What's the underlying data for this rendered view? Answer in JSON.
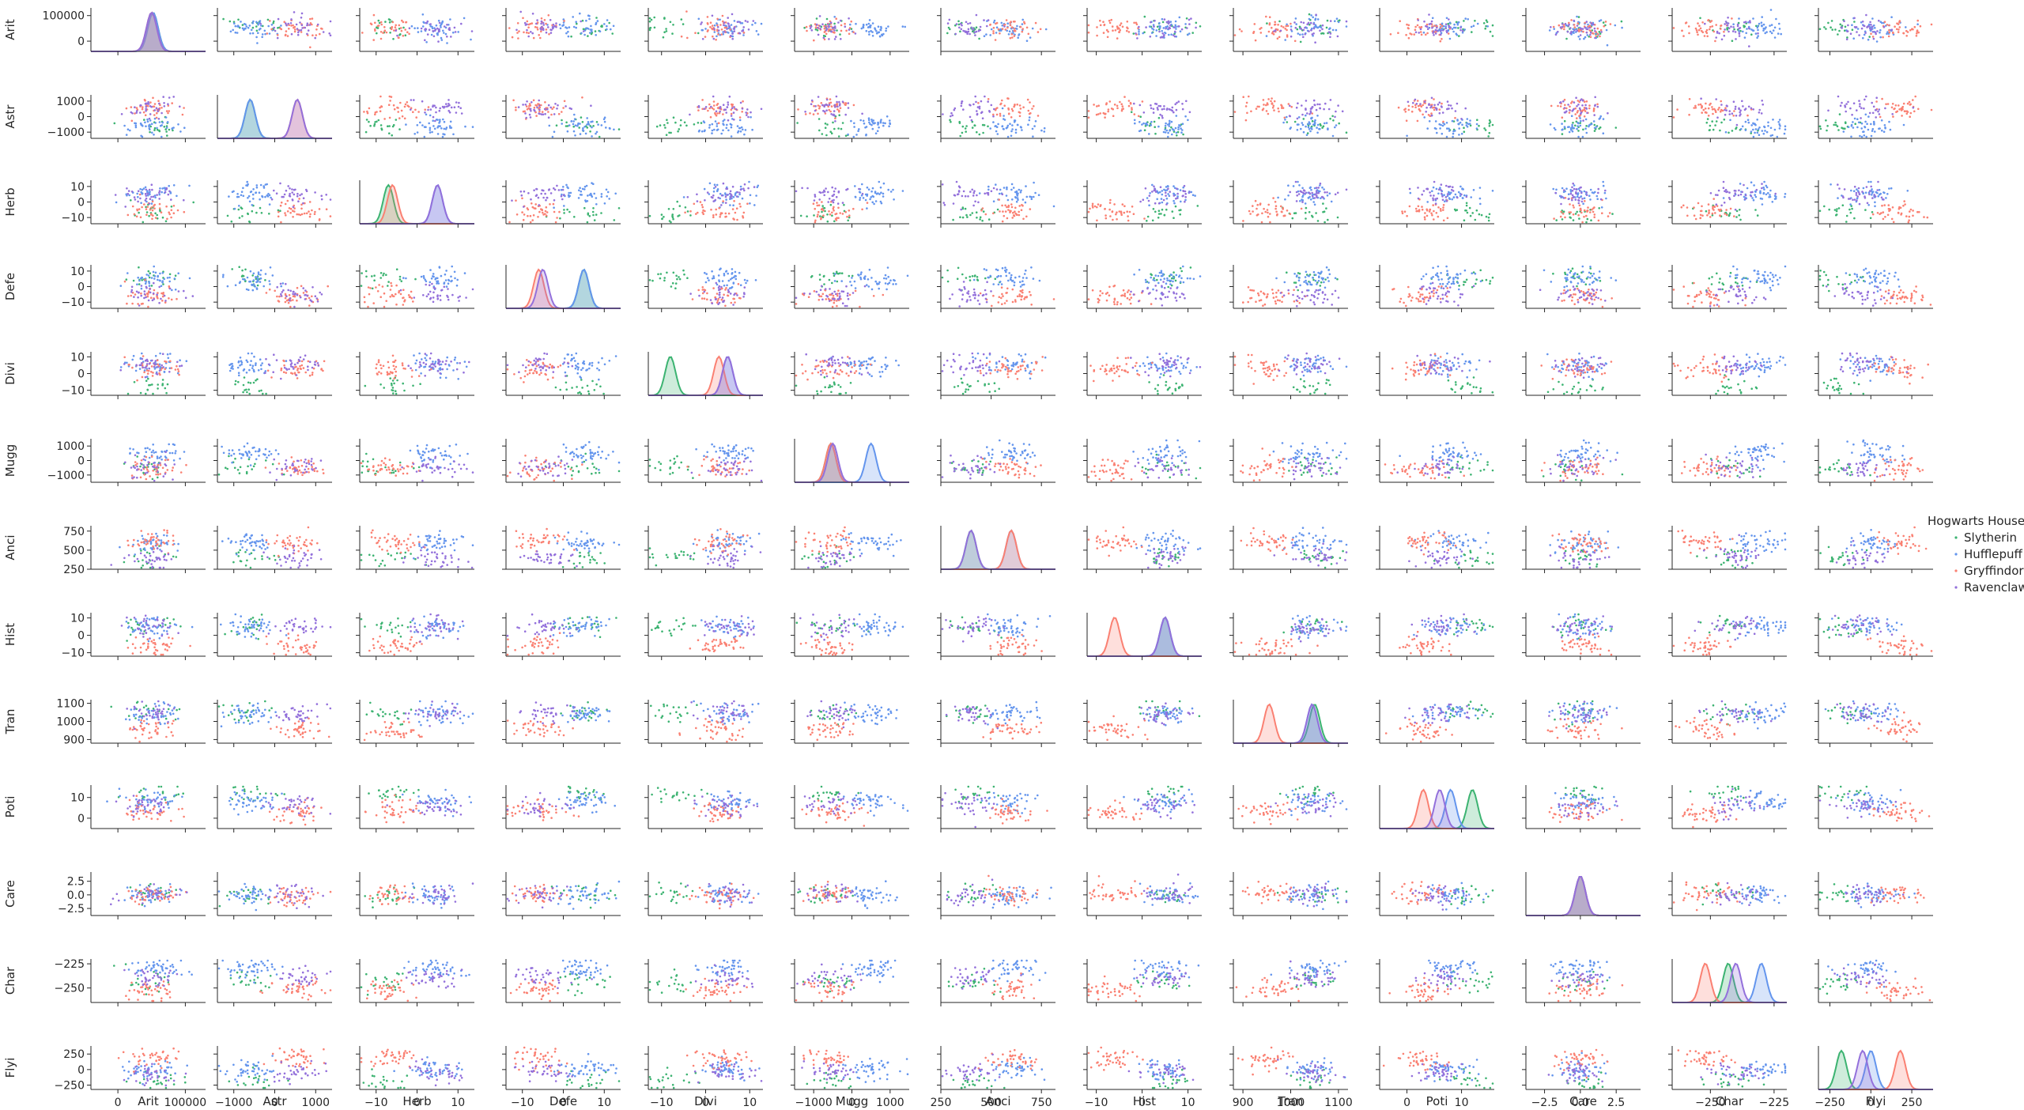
{
  "chart_data": {
    "type": "scatter",
    "subtype": "pairplot",
    "diagonal": "kde",
    "variables": [
      "Arit",
      "Astr",
      "Herb",
      "Defe",
      "Divi",
      "Mugg",
      "Anci",
      "Hist",
      "Tran",
      "Poti",
      "Care",
      "Char",
      "Flyi"
    ],
    "ranges": {
      "Arit": [
        -40000,
        130000
      ],
      "Astr": [
        -1400,
        1400
      ],
      "Herb": [
        -14,
        14
      ],
      "Defe": [
        -14,
        14
      ],
      "Divi": [
        -13,
        13
      ],
      "Mugg": [
        -1500,
        1500
      ],
      "Anci": [
        250,
        820
      ],
      "Hist": [
        -12,
        13
      ],
      "Tran": [
        880,
        1120
      ],
      "Poti": [
        -5,
        16
      ],
      "Care": [
        -3.8,
        4.2
      ],
      "Char": [
        -265,
        -220
      ],
      "Flyi": [
        -320,
        380
      ]
    },
    "ticks": {
      "Arit": {
        "values": [
          0,
          100000
        ],
        "labels": [
          "0",
          "100000"
        ]
      },
      "Astr": {
        "values": [
          -1000,
          0,
          1000
        ],
        "labels": [
          "−1000",
          "0",
          "1000"
        ]
      },
      "Herb": {
        "values": [
          -10,
          0,
          10
        ],
        "labels": [
          "−10",
          "0",
          "10"
        ]
      },
      "Defe": {
        "values": [
          -10,
          0,
          10
        ],
        "labels": [
          "−10",
          "0",
          "10"
        ]
      },
      "Divi": {
        "values": [
          -10,
          0,
          10
        ],
        "labels": [
          "−10",
          "0",
          "10"
        ]
      },
      "Mugg": {
        "values": [
          -1000,
          0,
          1000
        ],
        "labels": [
          "−1000",
          "0",
          "1000"
        ]
      },
      "Anci": {
        "values": [
          250,
          500,
          750
        ],
        "labels": [
          "250",
          "500",
          "750"
        ]
      },
      "Hist": {
        "values": [
          -10,
          0,
          10
        ],
        "labels": [
          "−10",
          "0",
          "10"
        ]
      },
      "Tran": {
        "values": [
          900,
          1000,
          1100
        ],
        "labels": [
          "900",
          "1000",
          "1100"
        ]
      },
      "Poti": {
        "values": [
          0,
          10
        ],
        "labels": [
          "0",
          "10"
        ]
      },
      "Care": {
        "values": [
          -2.5,
          0,
          2.5
        ],
        "labels": [
          "−2.5",
          "0.0",
          "2.5"
        ]
      },
      "Char": {
        "values": [
          -250,
          -225
        ],
        "labels": [
          "−250",
          "−225"
        ]
      },
      "Flyi": {
        "values": [
          -250,
          0,
          250
        ],
        "labels": [
          "−250",
          "0",
          "250"
        ]
      }
    },
    "legend": {
      "title": "Hogwarts House",
      "placement": "right",
      "entries": [
        {
          "name": "Slytherin",
          "color": "#3cb371"
        },
        {
          "name": "Hufflepuff",
          "color": "#6495ed"
        },
        {
          "name": "Gryffindor",
          "color": "#fa8072"
        },
        {
          "name": "Ravenclaw",
          "color": "#9370db"
        }
      ]
    },
    "series": [
      {
        "name": "Slytherin",
        "color": "#3cb371",
        "points_per_panel": 20,
        "means": [
          52000,
          -600,
          -7,
          5,
          -8,
          -550,
          400,
          5,
          1050,
          12,
          0,
          -243,
          -180
        ]
      },
      {
        "name": "Hufflepuff",
        "color": "#6495ed",
        "points_per_panel": 45,
        "means": [
          52000,
          -600,
          5,
          5,
          5,
          500,
          600,
          5,
          1045,
          8,
          0,
          -230,
          0
        ]
      },
      {
        "name": "Gryffindor",
        "color": "#fa8072",
        "points_per_panel": 40,
        "means": [
          50000,
          550,
          -6,
          -6,
          3,
          -550,
          600,
          -6,
          955,
          3,
          0,
          -252,
          180
        ]
      },
      {
        "name": "Ravenclaw",
        "color": "#9370db",
        "points_per_panel": 35,
        "means": [
          50000,
          550,
          5,
          -5,
          5,
          -500,
          400,
          5,
          1045,
          6,
          0,
          -240,
          -50
        ]
      }
    ]
  }
}
